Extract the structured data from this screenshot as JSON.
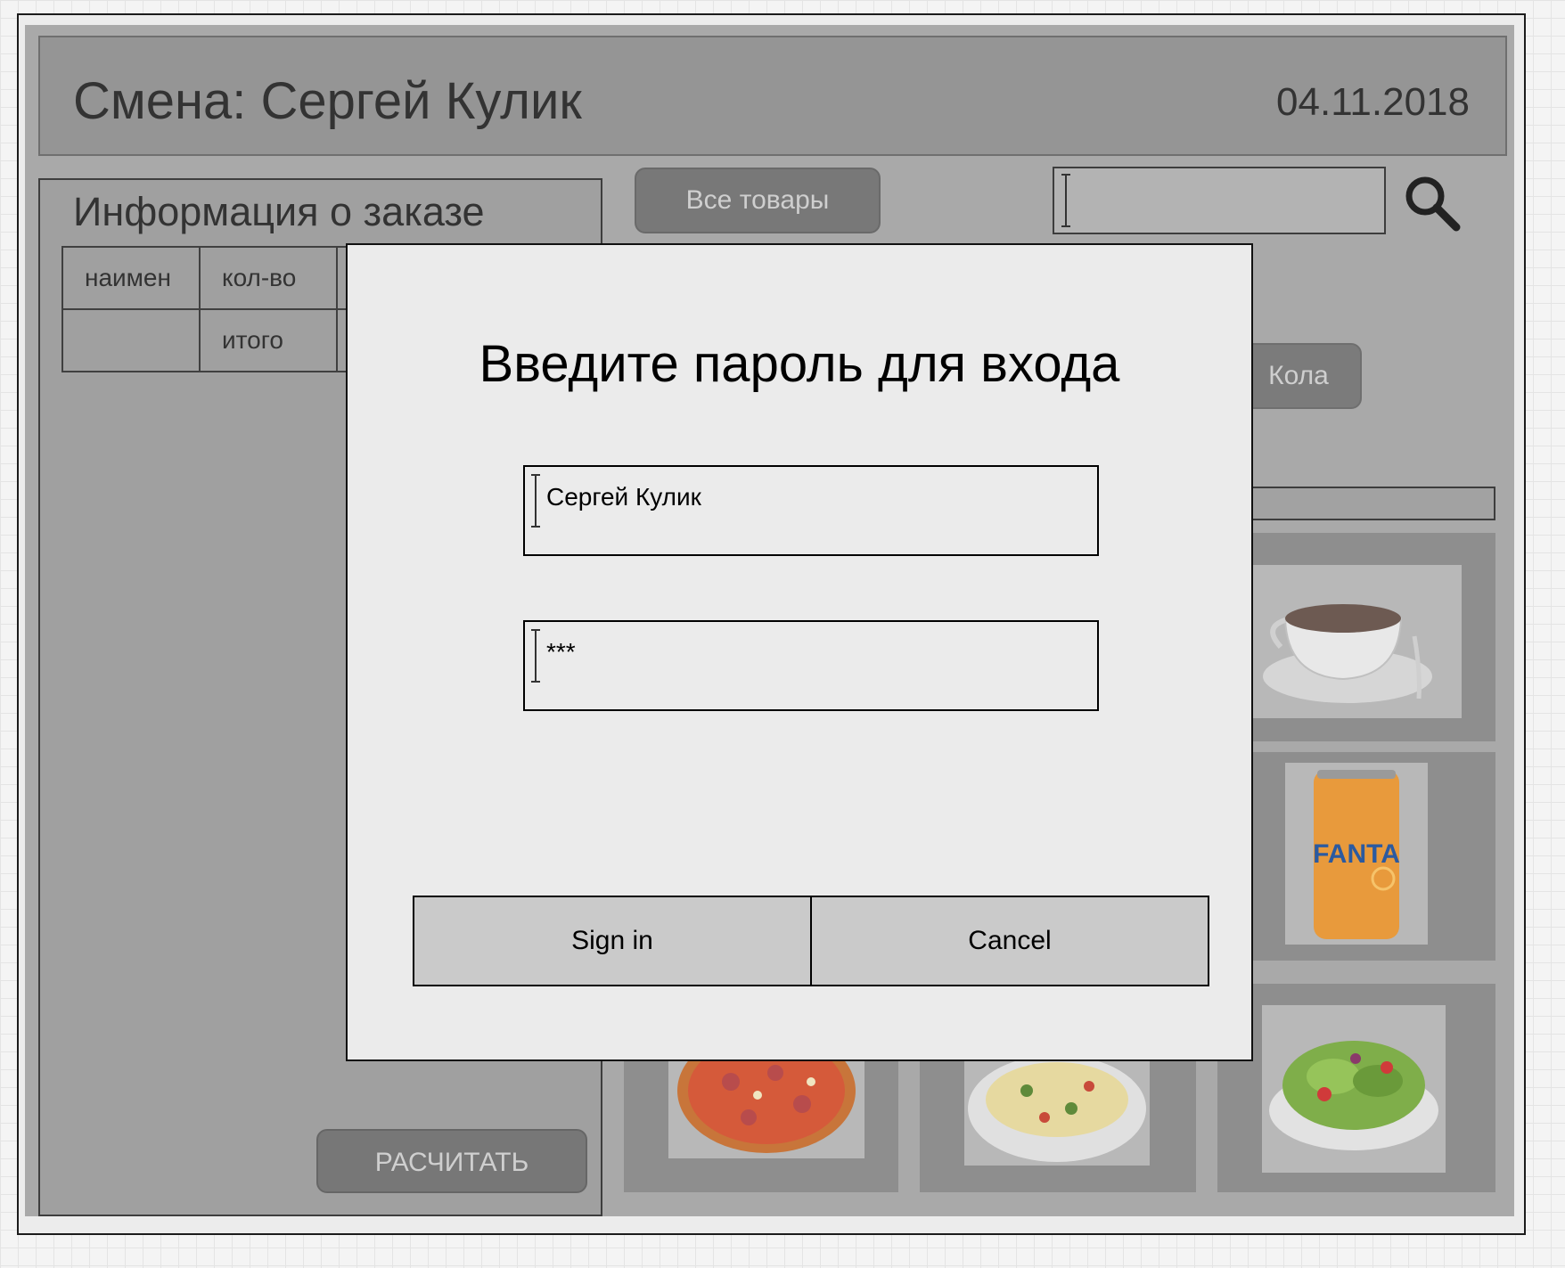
{
  "header": {
    "title": "Смена: Сергей Кулик",
    "date": "04.11.2018"
  },
  "order": {
    "title": "Информация о заказе",
    "col_name": "наимен",
    "col_qty": "кол-во",
    "total_label": "итого",
    "calc_button": "РАСЧИТАТЬ"
  },
  "products": {
    "all_button": "Все товары",
    "search_value": "",
    "category_button": "Кола",
    "tiles": [
      {
        "name": "coffee-tile",
        "icon": "coffee-cup-icon"
      },
      {
        "name": "fanta-tile",
        "icon": "fanta-can-icon",
        "label": "FANTA"
      },
      {
        "name": "pizza-tile",
        "icon": "pizza-icon"
      },
      {
        "name": "pasta-tile",
        "icon": "pasta-icon"
      },
      {
        "name": "salad-tile",
        "icon": "salad-icon"
      }
    ]
  },
  "dialog": {
    "title": "Введите пароль для входа",
    "username": "Сергей Кулик",
    "password": "***",
    "sign_in": "Sign in",
    "cancel": "Cancel"
  },
  "colors": {
    "overlay_gray": "#a9a9a9",
    "dialog_bg": "#ebebeb",
    "button_gray": "#cacaca"
  }
}
